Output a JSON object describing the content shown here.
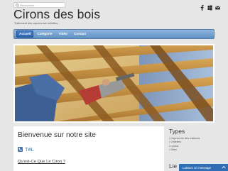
{
  "header": {
    "search_placeholder": "Rechercher",
    "site_title": "Cirons des bois",
    "tagline": "Traitement des capricornes orillettes...",
    "social_icons": [
      "facebook-icon",
      "windows-icon",
      "email-icon"
    ]
  },
  "nav": {
    "items": [
      "Accueil",
      "Catégorie",
      "Vidéo",
      "Contact"
    ],
    "active": "Accueil"
  },
  "content": {
    "heading": "Bienvenue sur notre site",
    "phone_label": "TéL",
    "faq_link": "Qu'est-Ce Que Le Ciron ?"
  },
  "sidebar": {
    "title": "Types",
    "items": [
      "Capricorne des maisons",
      "Vrillettes",
      "Lyctus",
      "Sirex"
    ],
    "title2": "Lie"
  },
  "chat": {
    "label": "Laissez un message"
  },
  "colors": {
    "nav_gradient_top": "#8fb6de",
    "nav_gradient_bottom": "#5f8fc3",
    "accent_blue": "#2f6db5",
    "page_background": "#e6e6e6"
  }
}
